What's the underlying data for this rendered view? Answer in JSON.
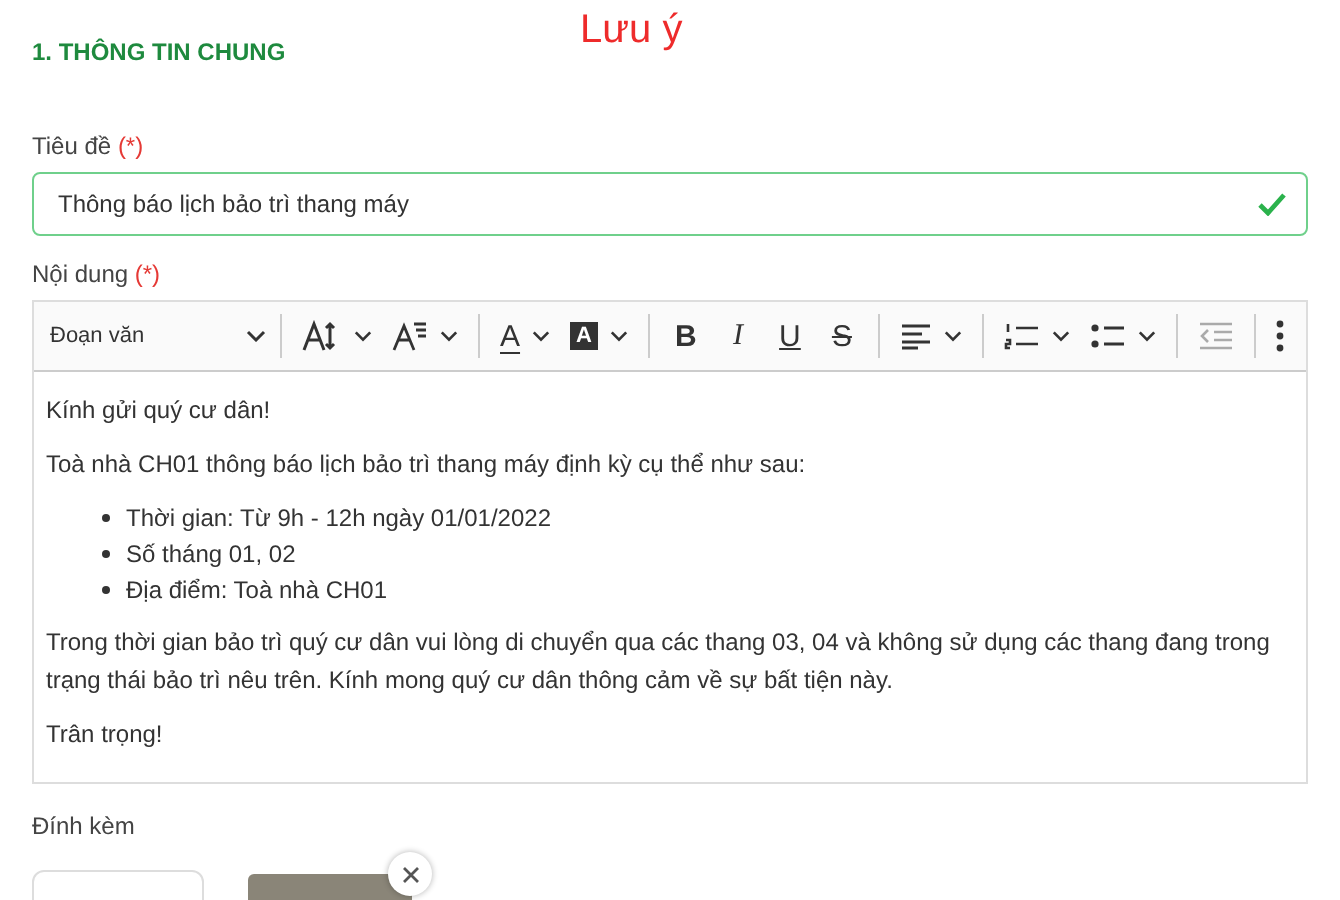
{
  "section_title": "1. THÔNG TIN CHUNG",
  "note": "Lưu ý",
  "title_field": {
    "label": "Tiêu đề",
    "required_mark": "(*)",
    "value": "Thông báo lịch bảo trì thang máy",
    "valid": true
  },
  "content_field": {
    "label": "Nội dung",
    "required_mark": "(*)"
  },
  "toolbar": {
    "paragraph_style": "Đoạn văn",
    "groups": [
      [
        {
          "kind": "font-size",
          "dropdown": true
        },
        {
          "kind": "font-family",
          "dropdown": true
        }
      ],
      [
        {
          "kind": "font-color",
          "label": "A",
          "dropdown": true
        },
        {
          "kind": "highlight",
          "label": "A",
          "dropdown": true
        }
      ],
      [
        {
          "kind": "bold",
          "label": "B"
        },
        {
          "kind": "italic",
          "label": "I"
        },
        {
          "kind": "underline",
          "label": "U"
        },
        {
          "kind": "strike",
          "label": "S"
        }
      ],
      [
        {
          "kind": "align",
          "dropdown": true
        }
      ],
      [
        {
          "kind": "numbered-list",
          "dropdown": true
        },
        {
          "kind": "bullet-list",
          "dropdown": true
        }
      ],
      [
        {
          "kind": "outdent",
          "disabled": true
        }
      ],
      [
        {
          "kind": "more"
        }
      ]
    ]
  },
  "body": [
    {
      "kind": "paragraph",
      "text": "Kính gửi quý cư dân!"
    },
    {
      "kind": "paragraph",
      "text": "Toà nhà CH01 thông báo lịch bảo trì thang máy định kỳ cụ thể như sau:"
    },
    {
      "kind": "list",
      "items": [
        "Thời gian: Từ 9h - 12h ngày 01/01/2022",
        "Số tháng 01, 02",
        "Địa điểm: Toà nhà CH01"
      ]
    },
    {
      "kind": "paragraph",
      "text": "Trong thời gian bảo trì quý cư dân vui lòng di chuyển qua các thang 03, 04 và không sử dụng các thang đang trong trạng thái bảo trì nêu trên. Kính mong quý cư dân thông cảm về sự bất tiện này."
    },
    {
      "kind": "paragraph",
      "text": "Trân trọng!"
    }
  ],
  "attachments": {
    "label": "Đính kèm",
    "items": [
      {
        "kind": "add"
      },
      {
        "kind": "image",
        "removable": true
      }
    ]
  }
}
